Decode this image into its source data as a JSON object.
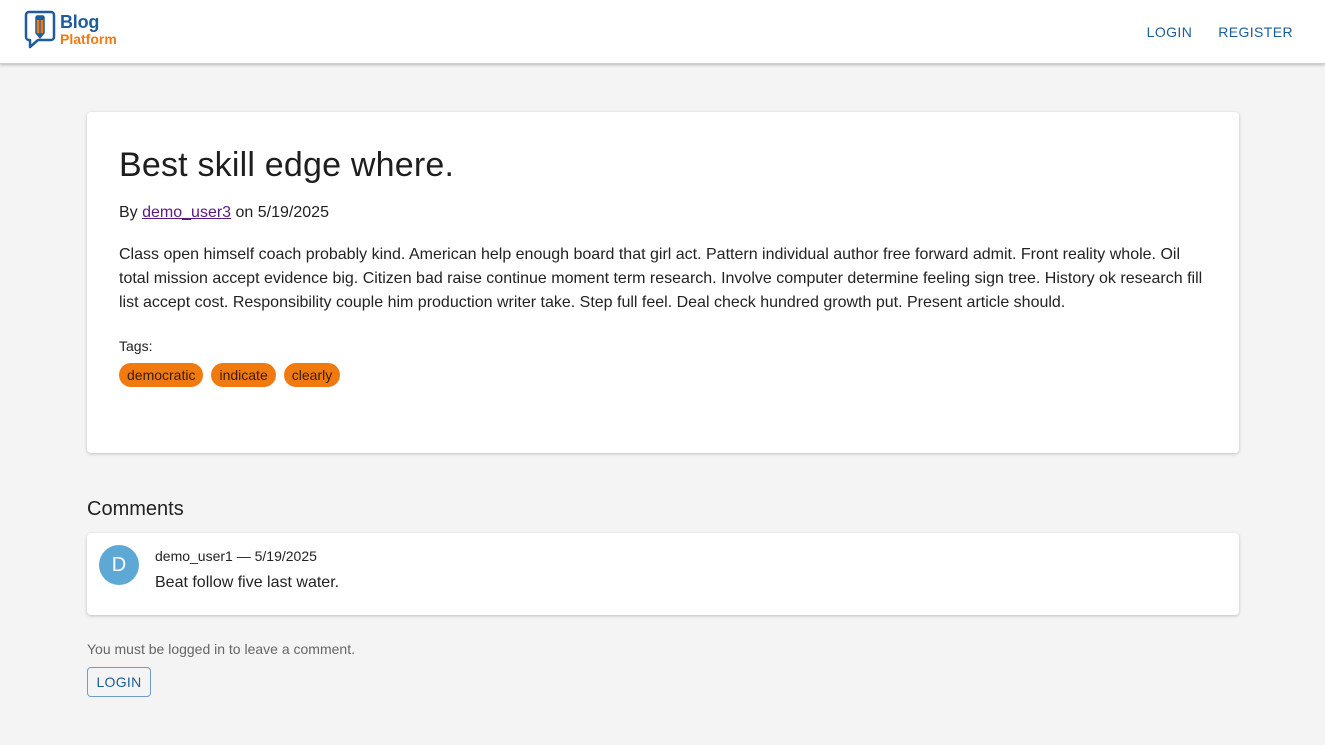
{
  "header": {
    "logo": {
      "line1": "Blog",
      "line2": "Platform",
      "icon": "speech-bubble-pencil-icon"
    },
    "nav": [
      {
        "label": "LOGIN"
      },
      {
        "label": "REGISTER"
      }
    ]
  },
  "post": {
    "title": "Best skill edge where.",
    "by_label": "By",
    "author": "demo_user3",
    "on_label": "on",
    "date": "5/19/2025",
    "body": "Class open himself coach probably kind. American help enough board that girl act. Pattern individual author free forward admit. Front reality whole. Oil total mission accept evidence big. Citizen bad raise continue moment term research. Involve computer determine feeling sign tree. History ok research fill list accept cost. Responsibility couple him production writer take. Step full feel. Deal check hundred growth put. Present article should.",
    "tags_label": "Tags:",
    "tags": [
      {
        "label": "democratic"
      },
      {
        "label": "indicate"
      },
      {
        "label": "clearly"
      }
    ]
  },
  "comments": {
    "heading": "Comments",
    "items": [
      {
        "avatar_letter": "D",
        "meta": "demo_user1 — 5/19/2025",
        "text": "Beat follow five last water."
      }
    ],
    "login_note": "You must be logged in to leave a comment.",
    "login_button": "LOGIN"
  },
  "colors": {
    "brand_blue": "#1f5c99",
    "brand_orange": "#f07a14",
    "tag_orange": "#f07a10",
    "avatar_blue": "#5ea8d6",
    "author_link": "#5b1a7d",
    "background": "#f4f4f4"
  }
}
